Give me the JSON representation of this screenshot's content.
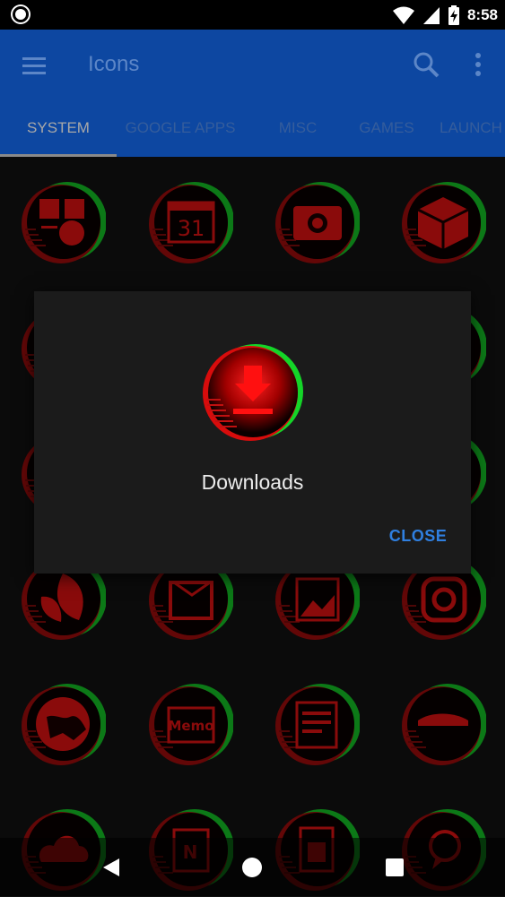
{
  "status_bar": {
    "time": "8:58",
    "icons": [
      "notification-dot-icon",
      "wifi-icon",
      "signal-icon",
      "battery-charging-icon"
    ]
  },
  "app_bar": {
    "title": "Icons",
    "icons": [
      "menu-icon",
      "search-icon",
      "overflow-menu-icon"
    ],
    "color": "#0d47a1"
  },
  "tabs": [
    {
      "label": "SYSTEM",
      "active": true
    },
    {
      "label": "GOOGLE APPS",
      "active": false
    },
    {
      "label": "MISC",
      "active": false
    },
    {
      "label": "GAMES",
      "active": false
    },
    {
      "label": "LAUNCH",
      "active": false
    }
  ],
  "icon_grid": {
    "rows": [
      [
        "calculator-icon",
        "calendar-icon",
        "camera-icon",
        "cube-icon"
      ],
      [
        "app-icon",
        "app-icon",
        "app-icon",
        "app-icon"
      ],
      [
        "app-icon",
        "app-icon",
        "app-icon",
        "app-icon"
      ],
      [
        "leaf-icon",
        "inbox-icon",
        "gallery-icon",
        "instagram-icon"
      ],
      [
        "globe-icon",
        "memo-icon",
        "news-icon",
        "landscape-icon"
      ],
      [
        "cloud-upload-icon",
        "onenote-icon",
        "sim-card-icon",
        "messenger-icon"
      ]
    ],
    "memo_label": "Memo",
    "calendar_label": "31",
    "accent_colors": {
      "red": "#e01010",
      "green": "#12c424",
      "dark": "#050505"
    }
  },
  "dialog": {
    "icon": "downloads-icon",
    "title": "Downloads",
    "close_label": "CLOSE"
  },
  "nav_bar": {
    "icons": [
      "back-icon",
      "home-icon",
      "recents-icon"
    ]
  }
}
